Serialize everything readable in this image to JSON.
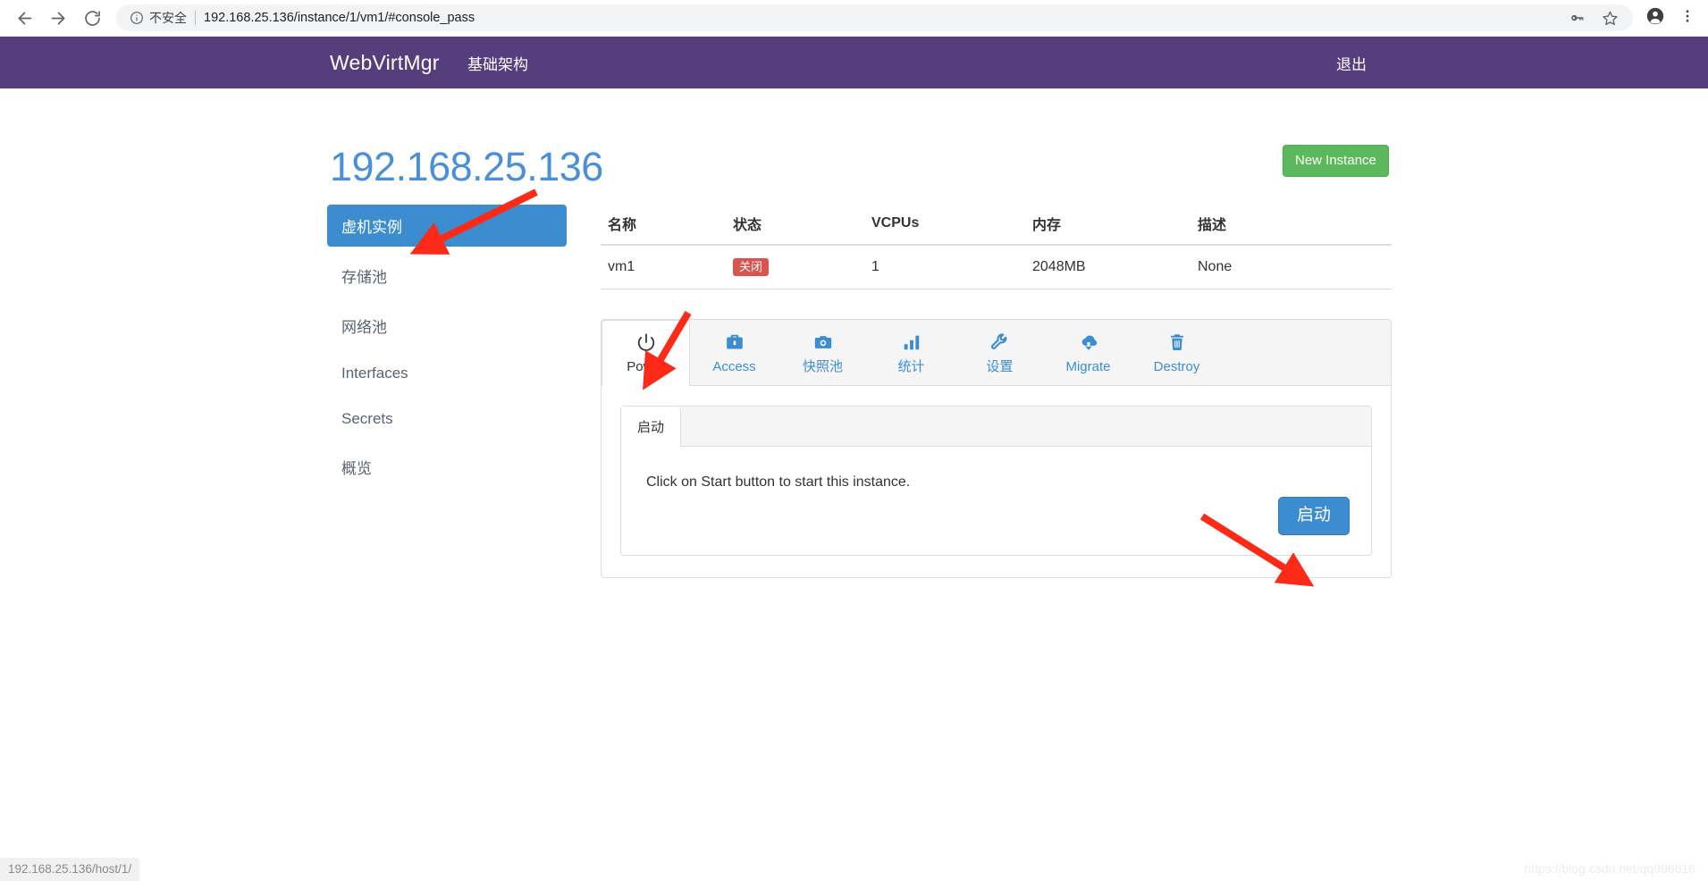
{
  "browser": {
    "back_icon": "arrow-left-icon",
    "forward_icon": "arrow-right-icon",
    "reload_icon": "reload-icon",
    "info_icon": "info-circle-icon",
    "security_label": "不安全",
    "url": "192.168.25.136/instance/1/vm1/#console_pass",
    "key_icon": "key-icon",
    "bookmark_icon": "star-icon",
    "profile_icon": "profile-avatar-icon",
    "menu_icon": "three-dot-menu-icon"
  },
  "navbar": {
    "brand": "WebVirtMgr",
    "link": "基础架构",
    "logout": "退出",
    "background": "#563d7c"
  },
  "page": {
    "title": "192.168.25.136",
    "title_color": "#4a90d9",
    "new_instance_label": "New Instance",
    "new_instance_color": "#5cb85c"
  },
  "sidebar": {
    "items": [
      {
        "label": "虚机实例",
        "active": true
      },
      {
        "label": "存储池",
        "active": false
      },
      {
        "label": "网络池",
        "active": false
      },
      {
        "label": "Interfaces",
        "active": false
      },
      {
        "label": "Secrets",
        "active": false
      },
      {
        "label": "概览",
        "active": false
      }
    ],
    "active_color": "#3c8dcf"
  },
  "table": {
    "headers": [
      "名称",
      "状态",
      "VCPUs",
      "内存",
      "描述"
    ],
    "rows": [
      {
        "name": "vm1",
        "state": "关闭",
        "state_color": "#d9534f",
        "vcpus": "1",
        "memory": "2048MB",
        "description": "None"
      }
    ]
  },
  "tabs": [
    {
      "label": "Power",
      "icon": "power-icon",
      "active": true
    },
    {
      "label": "Access",
      "icon": "briefcase-icon",
      "active": false
    },
    {
      "label": "快照池",
      "icon": "camera-icon",
      "active": false
    },
    {
      "label": "统计",
      "icon": "bar-chart-icon",
      "active": false
    },
    {
      "label": "设置",
      "icon": "wrench-icon",
      "active": false
    },
    {
      "label": "Migrate",
      "icon": "cloud-download-icon",
      "active": false
    },
    {
      "label": "Destroy",
      "icon": "trash-icon",
      "active": false
    }
  ],
  "power_panel": {
    "tab_label": "启动",
    "message": "Click on Start button to start this instance.",
    "start_button_label": "启动",
    "start_button_color": "#3c8dcf"
  },
  "statusbar": {
    "text": "192.168.25.136/host/1/"
  },
  "watermark": {
    "text": "https://blog.csdn.net/qq996616"
  }
}
